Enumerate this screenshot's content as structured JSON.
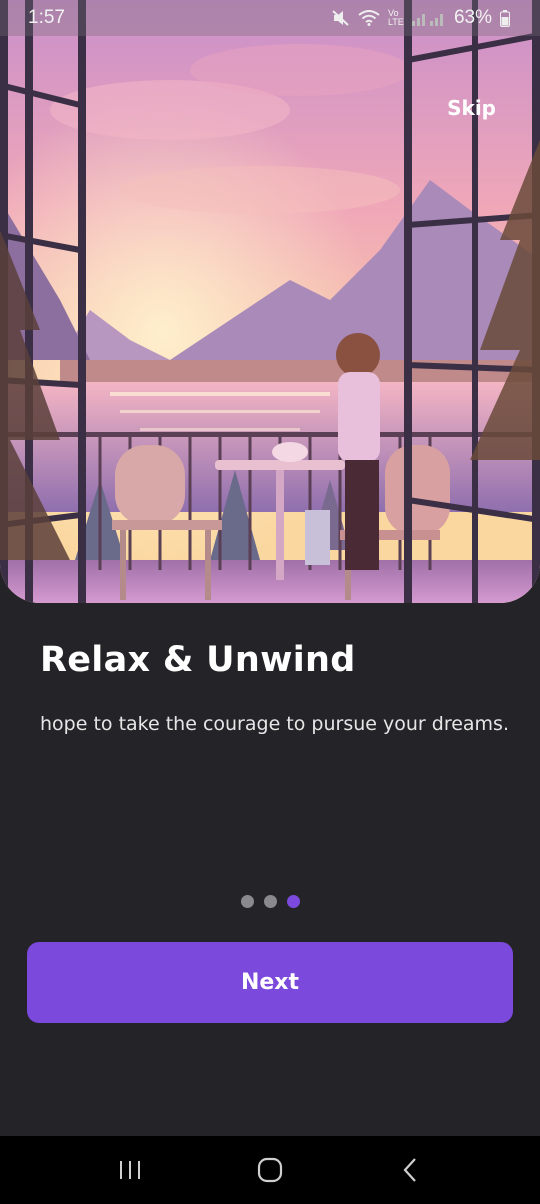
{
  "status_bar": {
    "time": "1:57",
    "network": "Vo LTE",
    "battery": "63%"
  },
  "onboarding": {
    "skip_label": "Skip",
    "title": "Relax & Unwind",
    "description": "hope to take the courage to pursue your dreams.",
    "page_count": 3,
    "active_page": 3,
    "next_label": "Next"
  },
  "navigation": {
    "recent_apps_icon": "recent-apps-icon",
    "home_icon": "home-icon",
    "back_icon": "back-icon"
  },
  "colors": {
    "background": "#242428",
    "accent": "#7b49dc",
    "dot_inactive": "#8a8a8e"
  }
}
